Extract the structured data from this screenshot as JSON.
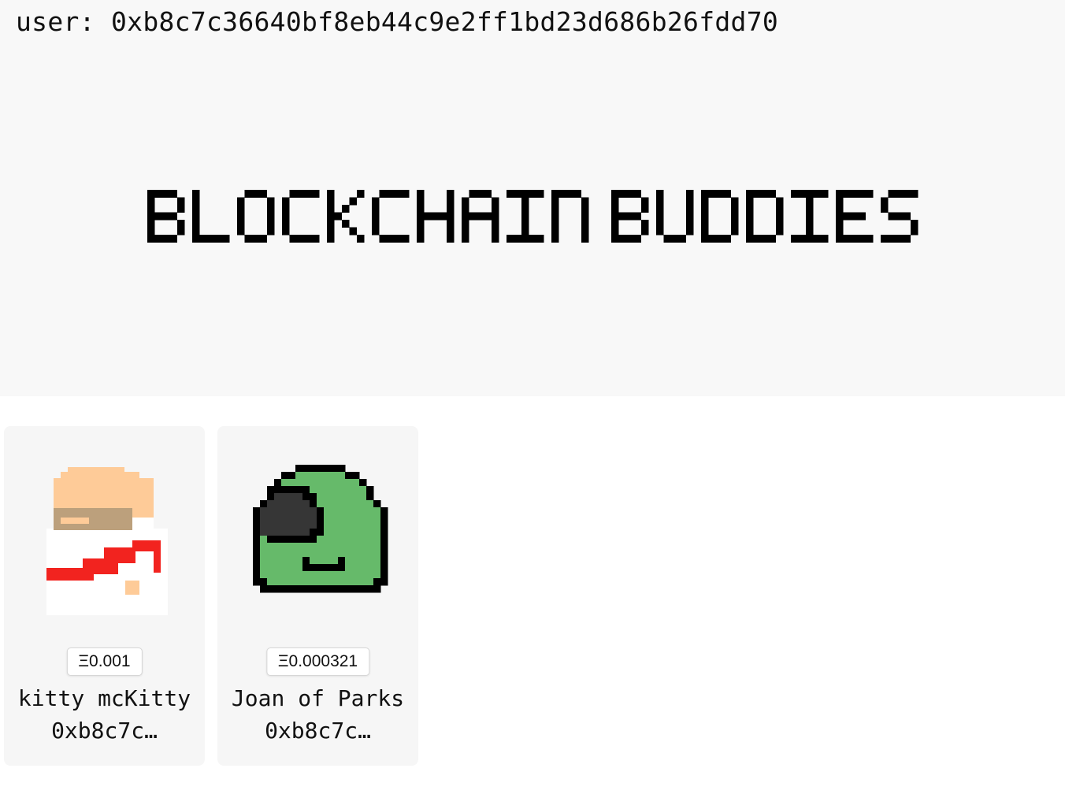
{
  "header": {
    "user_label": "user: 0xb8c7c36640bf8eb44c9e2ff1bd23d686b26fdd70",
    "title": "BLOCKCHAIN BUDDIES"
  },
  "buddies": [
    {
      "name": "kitty mcKitty",
      "owner": "0xb8c7c…",
      "price": "Ξ0.001",
      "image": "pixel-cat-icon"
    },
    {
      "name": "Joan of Parks",
      "owner": "0xb8c7c…",
      "price": "Ξ0.000321",
      "image": "pixel-blob-icon"
    }
  ],
  "colors": {
    "hero_background": "#f8f8f8",
    "card_background": "#f6f6f6",
    "title": "#000000",
    "cat_fur": "#fecb98",
    "cat_mask": "#bca07c",
    "cat_scarf": "#f2231f",
    "blob_body": "#66ba6a",
    "blob_outline": "#000000",
    "blob_eye": "#363636"
  }
}
